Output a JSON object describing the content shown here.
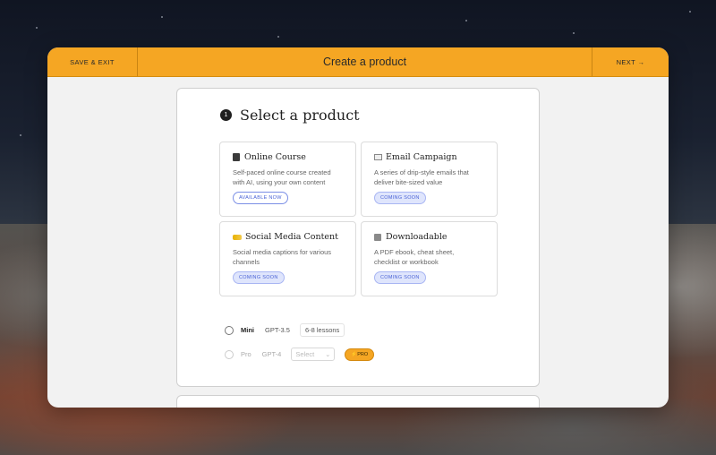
{
  "topbar": {
    "save_exit": "SAVE & EXIT",
    "title": "Create a product",
    "next": "NEXT →"
  },
  "step": {
    "number": "1",
    "title": "Select a product"
  },
  "products": [
    {
      "icon": "book-icon",
      "name": "Online Course",
      "desc_line1": "Self-paced online course created",
      "desc_line2": "with AI, using your own content",
      "badge": "AVAILABLE NOW"
    },
    {
      "icon": "envelope-icon",
      "name": "Email Campaign",
      "desc_line1": "A series of drip-style emails that",
      "desc_line2": "deliver bite-sized value",
      "badge": "COMING SOON"
    },
    {
      "icon": "megaphone-icon",
      "name": "Social Media Content",
      "desc_line1": "Social media captions for various",
      "desc_line2": "channels",
      "badge": "COMING SOON"
    },
    {
      "icon": "document-icon",
      "name": "Downloadable",
      "desc_line1": "A PDF ebook, cheat sheet,",
      "desc_line2": "checklist or workbook",
      "badge": "COMING SOON"
    }
  ],
  "models": {
    "mini": {
      "name": "Mini",
      "engine": "GPT-3.5",
      "lessons": "6-8 lessons"
    },
    "pro": {
      "name": "Pro",
      "engine": "GPT-4",
      "select_placeholder": "Select",
      "badge": "⚡PRO"
    }
  },
  "colors": {
    "accent": "#f5a623",
    "badge_blue": "#4a63d6"
  }
}
